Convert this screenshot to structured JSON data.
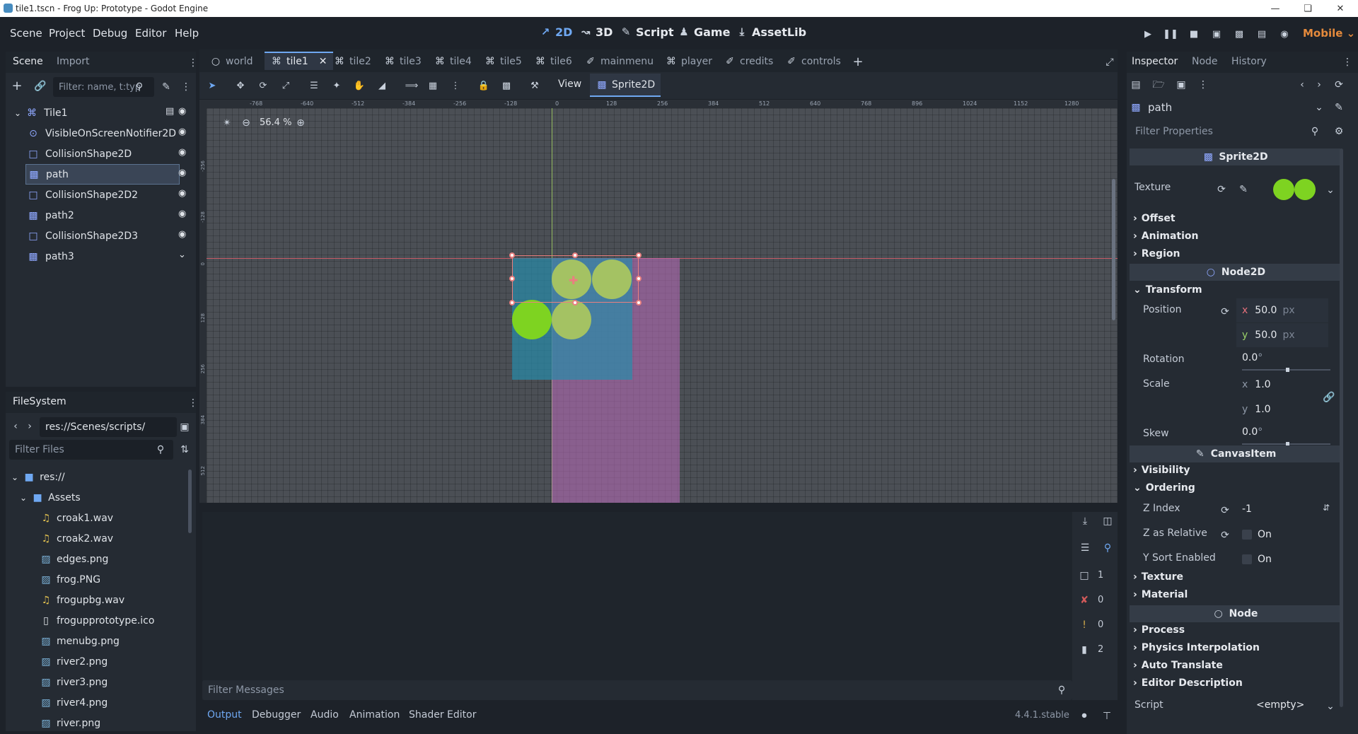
{
  "window": {
    "title": "tile1.tscn - Frog Up: Prototype - Godot Engine"
  },
  "menu": [
    "Scene",
    "Project",
    "Debug",
    "Editor",
    "Help"
  ],
  "workspaces": {
    "w2d": "2D",
    "w3d": "3D",
    "script": "Script",
    "game": "Game",
    "assetlib": "AssetLib"
  },
  "renderer": "Mobile",
  "scene_panel": {
    "tabs": [
      "Scene",
      "Import"
    ],
    "filter_placeholder": "Filter: name, t:typ",
    "nodes": [
      {
        "name": "Tile1",
        "icon": "node2d-icon"
      },
      {
        "name": "VisibleOnScreenNotifier2D",
        "icon": "notifier-icon"
      },
      {
        "name": "CollisionShape2D",
        "icon": "collision-icon"
      },
      {
        "name": "path",
        "icon": "sprite-icon"
      },
      {
        "name": "CollisionShape2D2",
        "icon": "collision-icon"
      },
      {
        "name": "path2",
        "icon": "sprite-icon"
      },
      {
        "name": "CollisionShape2D3",
        "icon": "collision-icon"
      },
      {
        "name": "path3",
        "icon": "sprite-icon"
      }
    ]
  },
  "filesystem": {
    "title": "FileSystem",
    "path": "res://Scenes/scripts/",
    "filter_placeholder": "Filter Files",
    "items": [
      {
        "name": "res://",
        "indent": 0,
        "type": "folder"
      },
      {
        "name": "Assets",
        "indent": 1,
        "type": "folder"
      },
      {
        "name": "croak1.wav",
        "indent": 2,
        "type": "audio"
      },
      {
        "name": "croak2.wav",
        "indent": 2,
        "type": "audio"
      },
      {
        "name": "edges.png",
        "indent": 2,
        "type": "image"
      },
      {
        "name": "frog.PNG",
        "indent": 2,
        "type": "image"
      },
      {
        "name": "frogupbg.wav",
        "indent": 2,
        "type": "audio"
      },
      {
        "name": "frogupprototype.ico",
        "indent": 2,
        "type": "file"
      },
      {
        "name": "menubg.png",
        "indent": 2,
        "type": "image"
      },
      {
        "name": "river2.png",
        "indent": 2,
        "type": "image"
      },
      {
        "name": "river3.png",
        "indent": 2,
        "type": "image"
      },
      {
        "name": "river4.png",
        "indent": 2,
        "type": "image"
      },
      {
        "name": "river.png",
        "indent": 2,
        "type": "image"
      }
    ]
  },
  "scene_tabs": [
    "world",
    "tile1",
    "tile2",
    "tile3",
    "tile4",
    "tile5",
    "tile6",
    "mainmenu",
    "player",
    "credits",
    "controls"
  ],
  "toolbar": {
    "view": "View",
    "node": "Sprite2D"
  },
  "viewport": {
    "zoom": "56.4 %",
    "ruler_labels": [
      "-768",
      "-640",
      "-512",
      "-384",
      "-256",
      "-128",
      "0",
      "128",
      "256",
      "384",
      "512",
      "640",
      "768",
      "896",
      "1024",
      "1152",
      "1280"
    ],
    "ruler_left_labels": [
      "-256",
      "-128",
      "0",
      "128",
      "256",
      "384",
      "512"
    ]
  },
  "output": {
    "filter_placeholder": "Filter Messages",
    "counts": [
      "1",
      "0",
      "0",
      "2"
    ],
    "tabs": [
      "Output",
      "Debugger",
      "Audio",
      "Animation",
      "Shader Editor"
    ],
    "version": "4.4.1.stable"
  },
  "inspector": {
    "tabs": [
      "Inspector",
      "Node",
      "History"
    ],
    "selected": "path",
    "filter_placeholder": "Filter Properties",
    "sprite_section": "Sprite2D",
    "texture_label": "Texture",
    "groups1": [
      "Offset",
      "Animation",
      "Region"
    ],
    "node2d_section": "Node2D",
    "transform": "Transform",
    "position_label": "Position",
    "pos_x": "50.0",
    "pos_y": "50.0",
    "unit_px": "px",
    "rotation_label": "Rotation",
    "rotation": "0.0",
    "deg": "°",
    "scale_label": "Scale",
    "scale_x": "1.0",
    "scale_y": "1.0",
    "skew_label": "Skew",
    "skew": "0.0",
    "canvas_section": "CanvasItem",
    "visibility": "Visibility",
    "ordering": "Ordering",
    "zindex_label": "Z Index",
    "zindex": "-1",
    "zrel_label": "Z as Relative",
    "on": "On",
    "ysort_label": "Y Sort Enabled",
    "groups2": [
      "Texture",
      "Material"
    ],
    "node_section": "Node",
    "groups3": [
      "Process",
      "Physics Interpolation",
      "Auto Translate",
      "Editor Description"
    ],
    "script_label": "Script",
    "script_value": "<empty>",
    "axis_x": "x",
    "axis_y": "y"
  },
  "colors": {
    "accent": "#6fa8f2",
    "selection": "#3a4556",
    "green": "#7ed321"
  }
}
